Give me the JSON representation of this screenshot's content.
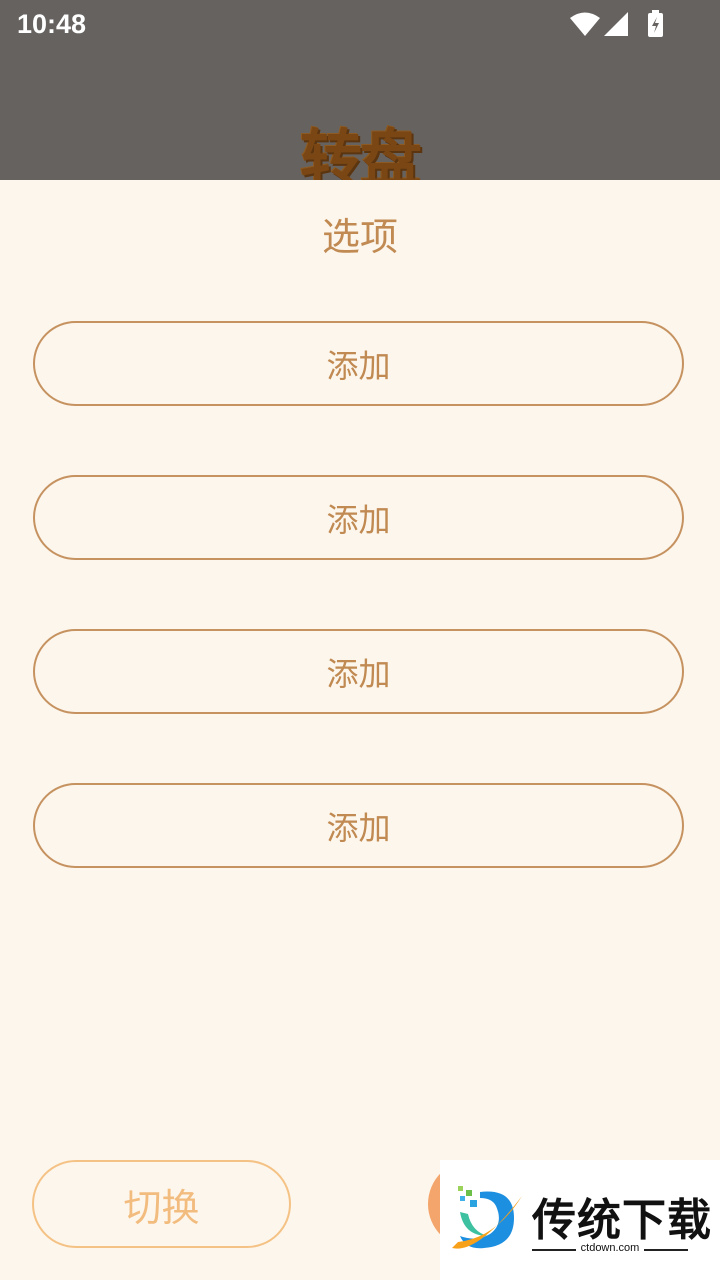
{
  "status_bar": {
    "time": "10:48",
    "icons": [
      "wifi-icon",
      "cellular-signal-icon",
      "battery-charging-icon"
    ]
  },
  "header": {
    "title": "转盘"
  },
  "options_panel": {
    "title": "选项",
    "add_buttons": [
      "添加",
      "添加",
      "添加",
      "添加"
    ]
  },
  "footer": {
    "switch_label": "切换"
  },
  "watermark": {
    "brand": "传统下载",
    "url": "ctdown.com"
  },
  "colors": {
    "panel_bg": "#fdf6ec",
    "accent_brown": "#c08a52",
    "switch_orange": "#f3bc7f",
    "confirm_orange": "#f3a56b",
    "dim_overlay": "#666260"
  }
}
